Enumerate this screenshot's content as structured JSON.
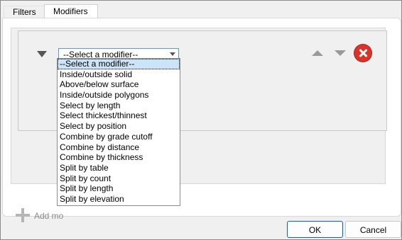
{
  "tabs": [
    {
      "label": "Filters"
    },
    {
      "label": "Modifiers"
    }
  ],
  "modifier": {
    "select_value": "--Select a modifier--",
    "options": [
      "--Select a modifier--",
      "Inside/outside solid",
      "Above/below surface",
      "Inside/outside polygons",
      "Select by length",
      "Select thickest/thinnest",
      "Select by position",
      "Combine by grade cutoff",
      "Combine by distance",
      "Combine by thickness",
      "Split by table",
      "Split by count",
      "Split by length",
      "Split by elevation"
    ]
  },
  "add_label": "Add mo",
  "buttons": {
    "ok": "OK",
    "cancel": "Cancel"
  },
  "colors": {
    "accent": "#0067c0",
    "delete": "#d9342b",
    "selection": "#cce4f7"
  },
  "icons": [
    "collapse-icon",
    "move-up-icon",
    "move-down-icon",
    "delete-icon",
    "plus-icon",
    "dropdown-arrow-icon"
  ]
}
